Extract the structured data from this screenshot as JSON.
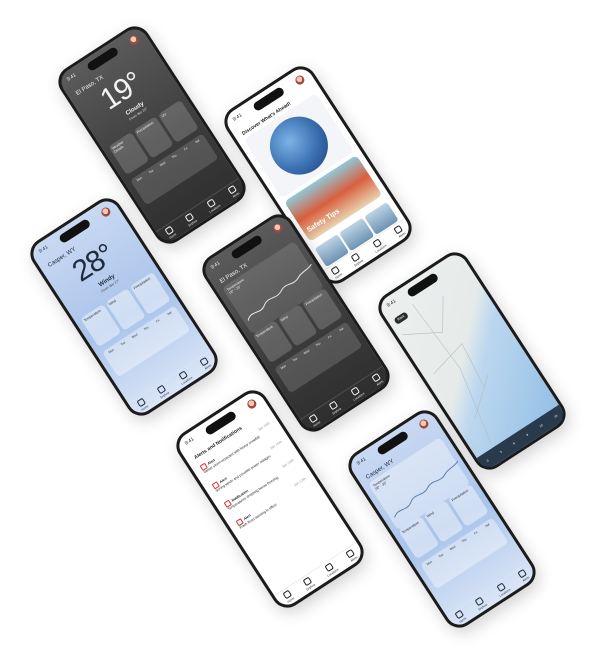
{
  "phones": {
    "p1": {
      "time": "9:41",
      "city": "El Paso, TX",
      "city_sub": "",
      "temp": "19°",
      "condition": "Cloudy",
      "condition_sub": "Feels like 20°",
      "cards": [
        "Weather Details",
        "Precipitation",
        "UV"
      ],
      "grid": [
        "Mon",
        "Tue",
        "Wed",
        "Thu",
        "Fri",
        "Sat",
        "0:00",
        "3:00",
        "6:00",
        "9:00",
        "12:00",
        "15:00"
      ],
      "tabs": [
        "Home",
        "Explore",
        "Locations",
        "Alerts"
      ]
    },
    "p2": {
      "time": "9:41",
      "header": "Discover What's Ahead!",
      "tile_title": "Safety Tips",
      "tabs": [
        "Home",
        "Explore",
        "Locations",
        "Alerts"
      ]
    },
    "p3": {
      "time": "9:41",
      "city": "Casper, WY",
      "temp": "28°",
      "condition": "Windy",
      "condition_sub": "Feels like 27°",
      "cards": [
        "Temperature",
        "Wind",
        "Precipitation"
      ],
      "grid": [
        "Mon",
        "Tue",
        "Wed",
        "Thu",
        "Fri",
        "Sat",
        "0:00",
        "3:00",
        "6:00",
        "9:00",
        "12:00",
        "15:00"
      ],
      "tabs": [
        "Home",
        "Explore",
        "Locations",
        "Alerts"
      ]
    },
    "p4": {
      "time": "9:41",
      "city": "El Paso, TX",
      "graph_label": "Temperature",
      "graph_value": "18° - 23°",
      "cards": [
        "Temperature",
        "Wind",
        "Precipitation"
      ],
      "grid": [
        "Mon",
        "Tue",
        "Wed",
        "Thu",
        "Fri",
        "Sat",
        "0:00",
        "3:00",
        "6:00",
        "9:00",
        "12:00",
        "15:00"
      ],
      "tabs": [
        "Home",
        "Explore",
        "Locations",
        "Alerts"
      ]
    },
    "p5": {
      "time": "9:41",
      "back": "Back",
      "tabs": [
        "0",
        "3",
        "6",
        "9",
        "12",
        "15"
      ]
    },
    "p6": {
      "time": "9:41",
      "header": "Alerts and Notifications",
      "alerts": [
        {
          "title": "Alert",
          "body": "Winter storm expected with heavy snowfall",
          "date": "Jan 16th"
        },
        {
          "title": "Alert",
          "body": "Strong winds and possible power outages",
          "date": "Jan 15th"
        },
        {
          "title": "Notification",
          "body": "Temperatures dropping below freezing",
          "date": "Jan 14th"
        },
        {
          "title": "Alert",
          "body": "Flash flood warning in effect",
          "date": "Jan 12th"
        }
      ],
      "tabs": [
        "Home",
        "Explore",
        "Locations",
        "Alerts"
      ]
    },
    "p7": {
      "time": "9:41",
      "city": "Casper, WY",
      "graph_label": "Temperature",
      "graph_value": "28° - 33°",
      "cards": [
        "Temperature",
        "Wind",
        "Precipitation"
      ],
      "grid": [
        "Mon",
        "Tue",
        "Wed",
        "Thu",
        "Fri",
        "Sat",
        "0:00",
        "3:00",
        "6:00",
        "9:00",
        "12:00",
        "15:00"
      ],
      "tabs": [
        "Home",
        "Explore",
        "Locations",
        "Alerts"
      ]
    }
  },
  "colors": {
    "accent": "#d33a2c",
    "dark_bg": "#3b3b3b",
    "blue_bg": "#a9c3ea"
  }
}
